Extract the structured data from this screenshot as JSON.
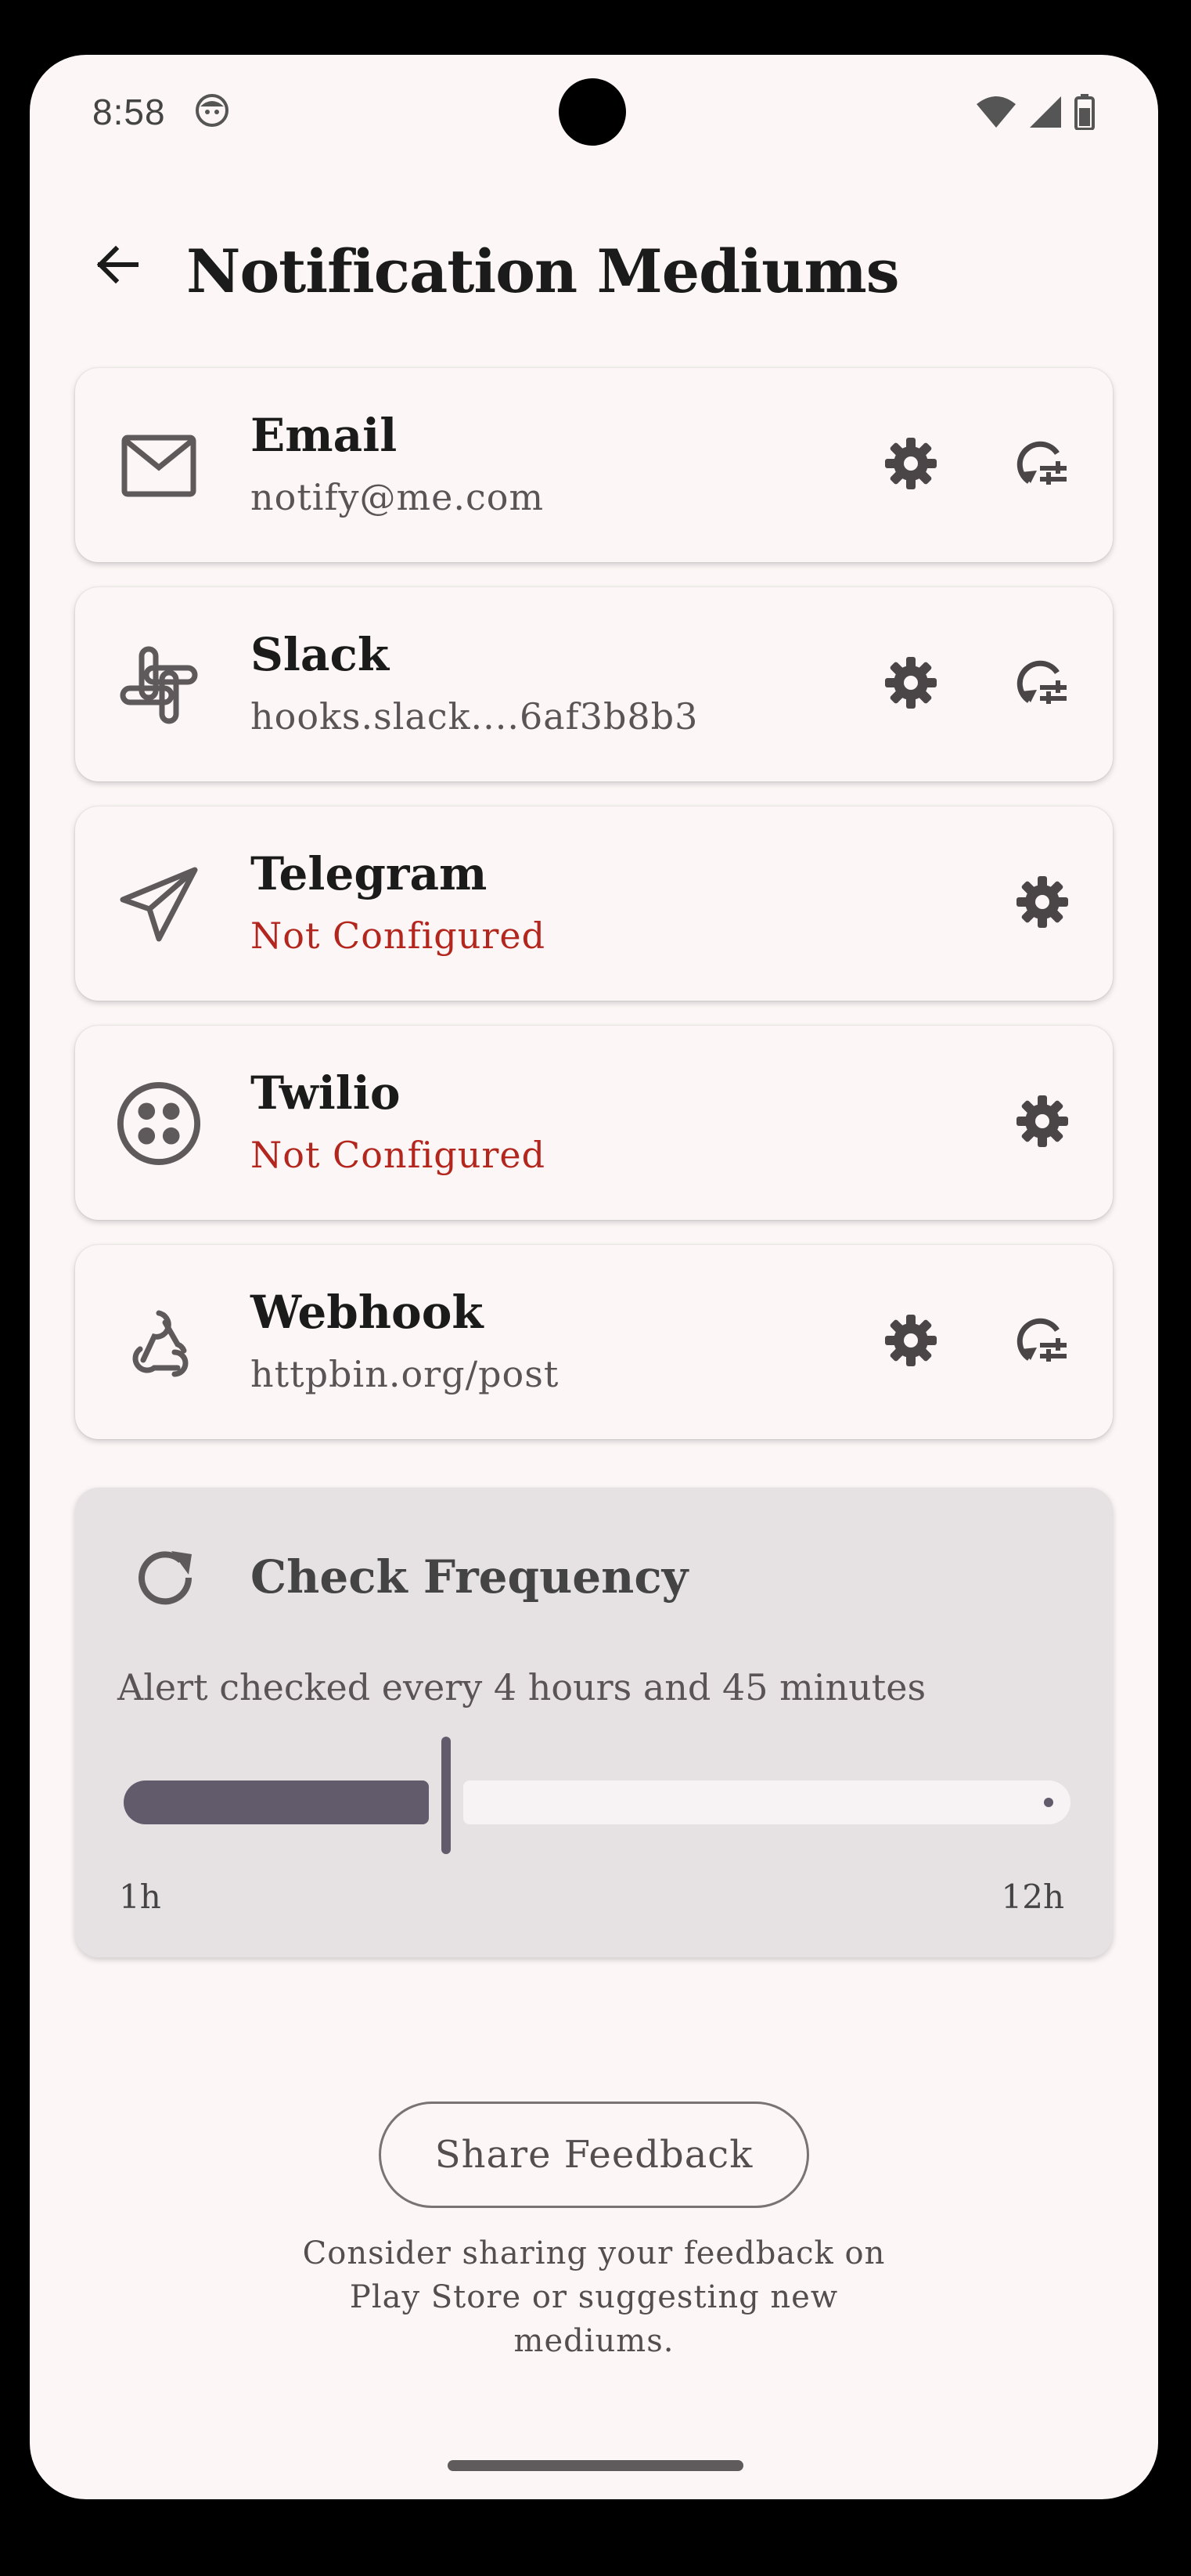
{
  "status_bar": {
    "time": "8:58"
  },
  "header": {
    "title": "Notification Mediums"
  },
  "mediums": [
    {
      "name": "Email",
      "detail": "notify@me.com",
      "icon": "mail-icon",
      "has_test": true
    },
    {
      "name": "Slack",
      "detail": "hooks.slack....6af3b8b3",
      "icon": "slack-icon",
      "has_test": true
    },
    {
      "name": "Telegram",
      "detail": "Not Configured",
      "icon": "telegram-icon",
      "has_test": false
    },
    {
      "name": "Twilio",
      "detail": "Not Configured",
      "icon": "twilio-icon",
      "has_test": false
    },
    {
      "name": "Webhook",
      "detail": "httpbin.org/post",
      "icon": "webhook-icon",
      "has_test": true
    }
  ],
  "frequency": {
    "title": "Check Frequency",
    "description": "Alert checked every 4 hours and 45 minutes",
    "min_label": "1h",
    "max_label": "12h",
    "min_hours": 1,
    "max_hours": 12,
    "value_hours": 4.75
  },
  "footer": {
    "share_label": "Share Feedback",
    "note": "Consider sharing your feedback on Play Store or suggesting new mediums."
  },
  "colors": {
    "background": "#fcf7f6",
    "error": "#b3261e",
    "slider_active": "#625b6c",
    "freq_card": "#e6e1e2"
  }
}
